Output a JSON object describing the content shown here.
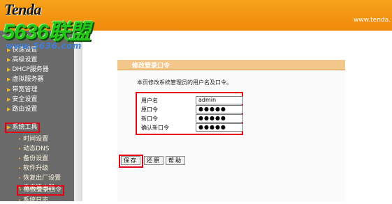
{
  "header": {
    "logo_text": "Tenda",
    "url_text": "www.tenda.",
    "watermark_big": "5636联盟",
    "watermark_small": "www.5636.com"
  },
  "sidebar": {
    "items": [
      {
        "label": "快速设置",
        "level": 0
      },
      {
        "label": "高级设置",
        "level": 0
      },
      {
        "label": "DHCP服务器",
        "level": 0
      },
      {
        "label": "虚拟服务器",
        "level": 0
      },
      {
        "label": "带宽管理",
        "level": 0
      },
      {
        "label": "安全设置",
        "level": 0
      },
      {
        "label": "路由设置",
        "level": 0
      },
      {
        "label": "系统工具",
        "level": 0
      },
      {
        "label": "时间设置",
        "level": 1
      },
      {
        "label": "动态DNS",
        "level": 1
      },
      {
        "label": "备份设置",
        "level": 1
      },
      {
        "label": "软件升级",
        "level": 1
      },
      {
        "label": "恢复出厂设置",
        "level": 1
      },
      {
        "label": "重启路由器",
        "level": 1
      },
      {
        "label": "修改登录口令",
        "level": 1
      },
      {
        "label": "系统日志",
        "level": 1
      }
    ]
  },
  "panel": {
    "title": "修改登录口令",
    "description": "本页修改系统管理员的用户名及口令。",
    "fields": [
      {
        "label": "用户名",
        "value": "admin"
      },
      {
        "label": "原口令",
        "value": "●●●●●"
      },
      {
        "label": "新口令",
        "value": "●●●●●"
      },
      {
        "label": "确认新口令",
        "value": "●●●●●"
      }
    ],
    "buttons": {
      "save": "保存",
      "restore": "还原",
      "help": "帮助"
    }
  },
  "colors": {
    "header_orange": "#f08a0a",
    "sidebar_gray": "#6a6a6a",
    "highlight_red": "#e60012",
    "panel_title": "#f3c78a"
  }
}
